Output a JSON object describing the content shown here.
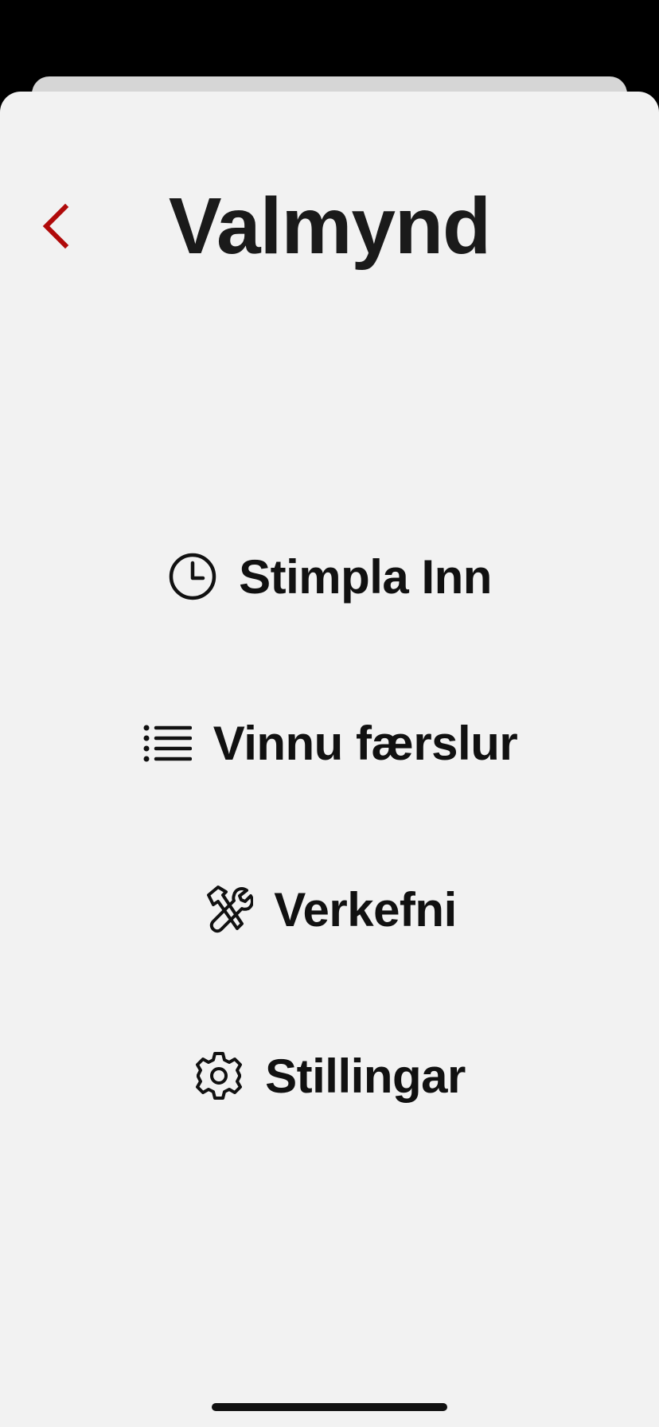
{
  "header": {
    "title": "Valmynd",
    "back_icon": "chevron-left-icon"
  },
  "menu": {
    "items": [
      {
        "label": "Stimpla Inn",
        "icon": "clock-icon"
      },
      {
        "label": "Vinnu færslur",
        "icon": "list-icon"
      },
      {
        "label": "Verkefni",
        "icon": "tools-icon"
      },
      {
        "label": "Stillingar",
        "icon": "gear-icon"
      }
    ]
  },
  "colors": {
    "accent": "#b00a0a",
    "background": "#f2f2f2",
    "text": "#111111"
  }
}
